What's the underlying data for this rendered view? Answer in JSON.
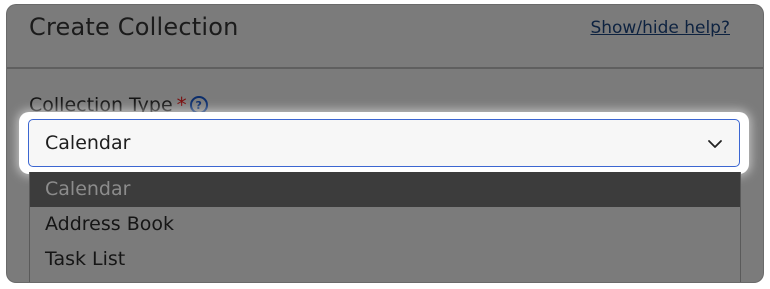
{
  "dialog": {
    "title": "Create Collection",
    "help_link": "Show/hide help?"
  },
  "field": {
    "label": "Collection Type",
    "required_marker": "*",
    "help_icon": "?",
    "selected_value": "Calendar",
    "options": [
      "Calendar",
      "Address Book",
      "Task List"
    ],
    "highlighted_option": "Calendar"
  },
  "colors": {
    "overlay": "#7b7b7b",
    "focus_border": "#3c66d1",
    "required": "#7a0d0d",
    "highlight_bg": "#3c3c3c"
  },
  "icons": {
    "dropdown": "chevron-down-icon",
    "help": "question-circle-icon"
  }
}
